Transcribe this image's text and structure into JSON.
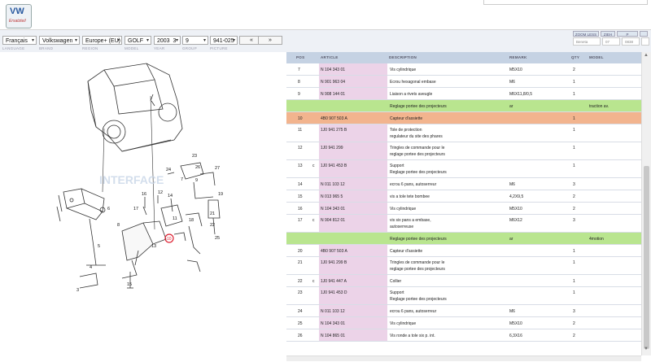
{
  "logo": {
    "text": "VW",
    "sub": "Ersatzteil"
  },
  "selectors": {
    "language": "Français",
    "brand": "Volkswagen",
    "region": "Europe+ (EU)",
    "model": "GOLF",
    "year": "2003",
    "year_sub": "3",
    "group": "9",
    "picture": "941-025",
    "prev": "«",
    "next": "»"
  },
  "labels": {
    "language": "LANGUAGE",
    "brand": "BRAND",
    "region": "REGION",
    "model": "MODEL",
    "year": "YEAR",
    "group": "GROUP",
    "picture": "PICTURE"
  },
  "right_controls": {
    "btn1": "ZOOM LESS",
    "btn2": "ZIEH",
    "btn3": "P",
    "field1": "Beneta",
    "field2": "07",
    "field3": "0838"
  },
  "diagram": {
    "watermark": "INTERFACE",
    "callouts": [
      "23",
      "24",
      "26",
      "27",
      "9",
      "7",
      "14",
      "12",
      "16",
      "10",
      "17",
      "18",
      "19",
      "8",
      "13",
      "15",
      "11",
      "21",
      "22",
      "25",
      "6",
      "5",
      "4",
      "3"
    ]
  },
  "table": {
    "headers": {
      "pos": "POS",
      "article": "ARTICLE",
      "description": "DESCRIPTION",
      "remark": "REMARK",
      "qty": "QTY",
      "model": "MODEL"
    },
    "rows": [
      {
        "type": "normal",
        "pos": "7",
        "c": "",
        "article": "N  104 343 01",
        "desc": [
          "Vis cylindrique"
        ],
        "remark": "M5X10",
        "qty": "2",
        "model": ""
      },
      {
        "type": "normal",
        "pos": "8",
        "c": "",
        "article": "N  901 963 04",
        "desc": [
          "Ecrou hexagonal embase"
        ],
        "remark": "M6",
        "qty": "1",
        "model": ""
      },
      {
        "type": "normal",
        "pos": "9",
        "c": "",
        "article": "N  908 144 01",
        "desc": [
          "Liaison a rivets aveugle"
        ],
        "remark": "M6X11,8/0,5",
        "qty": "1",
        "model": ""
      },
      {
        "type": "green",
        "pos": "",
        "c": "",
        "article": "",
        "desc": [
          "Reglage portee des projecteurs"
        ],
        "remark": "ar",
        "qty": "",
        "model": "traction av."
      },
      {
        "type": "orange",
        "pos": "10",
        "c": "",
        "article": "4B0 907 503 A",
        "desc": [
          "Capteur d'assiette"
        ],
        "remark": "",
        "qty": "1",
        "model": ""
      },
      {
        "type": "normal",
        "pos": "11",
        "c": "",
        "article": "1J0 941 275 B",
        "desc": [
          "Tole de protection",
          "regulateur du site des phares"
        ],
        "remark": "",
        "qty": "1",
        "model": ""
      },
      {
        "type": "normal",
        "pos": "12",
        "c": "",
        "article": "1J0 941 299",
        "desc": [
          "Tringles de commande pour le",
          "reglage portee des projecteurs"
        ],
        "remark": "",
        "qty": "1",
        "model": ""
      },
      {
        "type": "normal",
        "pos": "13",
        "c": "c",
        "article": "1J0 941 453 B",
        "desc": [
          "Support",
          "Reglage portee des projecteurs"
        ],
        "remark": "",
        "qty": "1",
        "model": ""
      },
      {
        "type": "normal",
        "pos": "14",
        "c": "",
        "article": "N  011 103 12",
        "desc": [
          "ecrou 6 pans, autoserreur"
        ],
        "remark": "M6",
        "qty": "3",
        "model": ""
      },
      {
        "type": "normal",
        "pos": "15",
        "c": "",
        "article": "N  013 965 5",
        "desc": [
          "vis a tole tete bombee"
        ],
        "remark": "4,2X9,5",
        "qty": "2",
        "model": ""
      },
      {
        "type": "normal",
        "pos": "16",
        "c": "",
        "article": "N  104 343 01",
        "desc": [
          "Vis cylindrique"
        ],
        "remark": "M5X10",
        "qty": "2",
        "model": ""
      },
      {
        "type": "normal",
        "pos": "17",
        "c": "c",
        "article": "N  904 812 01",
        "desc": [
          "vis six pans a embase,",
          "autoserreuse"
        ],
        "remark": "M6X12",
        "qty": "3",
        "model": ""
      },
      {
        "type": "green",
        "pos": "",
        "c": "",
        "article": "",
        "desc": [
          "Reglage portee des projecteurs"
        ],
        "remark": "ar",
        "qty": "",
        "model": "4motion"
      },
      {
        "type": "normal",
        "pos": "20",
        "c": "",
        "article": "4B0 907 503 A",
        "desc": [
          "Capteur d'assiette"
        ],
        "remark": "",
        "qty": "1",
        "model": ""
      },
      {
        "type": "normal",
        "pos": "21",
        "c": "",
        "article": "1J0 941 299 B",
        "desc": [
          "Tringles de commande pour le",
          "reglage portee des projecteurs"
        ],
        "remark": "",
        "qty": "1",
        "model": ""
      },
      {
        "type": "normal",
        "pos": "22",
        "c": "c",
        "article": "1J0 941 447 A",
        "desc": [
          "Collier"
        ],
        "remark": "",
        "qty": "1",
        "model": ""
      },
      {
        "type": "normal",
        "pos": "23",
        "c": "",
        "article": "1J0 941 453 D",
        "desc": [
          "Support",
          "Reglage portee des projecteurs"
        ],
        "remark": "",
        "qty": "1",
        "model": ""
      },
      {
        "type": "normal",
        "pos": "24",
        "c": "",
        "article": "N  011 103 12",
        "desc": [
          "ecrou 6 pans, autoserreur"
        ],
        "remark": "M6",
        "qty": "3",
        "model": ""
      },
      {
        "type": "normal",
        "pos": "25",
        "c": "",
        "article": "N  104 343 01",
        "desc": [
          "Vis cylindrique"
        ],
        "remark": "M5X10",
        "qty": "2",
        "model": ""
      },
      {
        "type": "normal",
        "pos": "26",
        "c": "",
        "article": "N  104 865 01",
        "desc": [
          "Vis ronde a tole six p. int."
        ],
        "remark": "6,3X16",
        "qty": "2",
        "model": ""
      }
    ]
  },
  "colors": {
    "header": "#c5d2e3",
    "green": "#b9e58f",
    "orange": "#f2b48e",
    "article": "#ecd3e8"
  }
}
